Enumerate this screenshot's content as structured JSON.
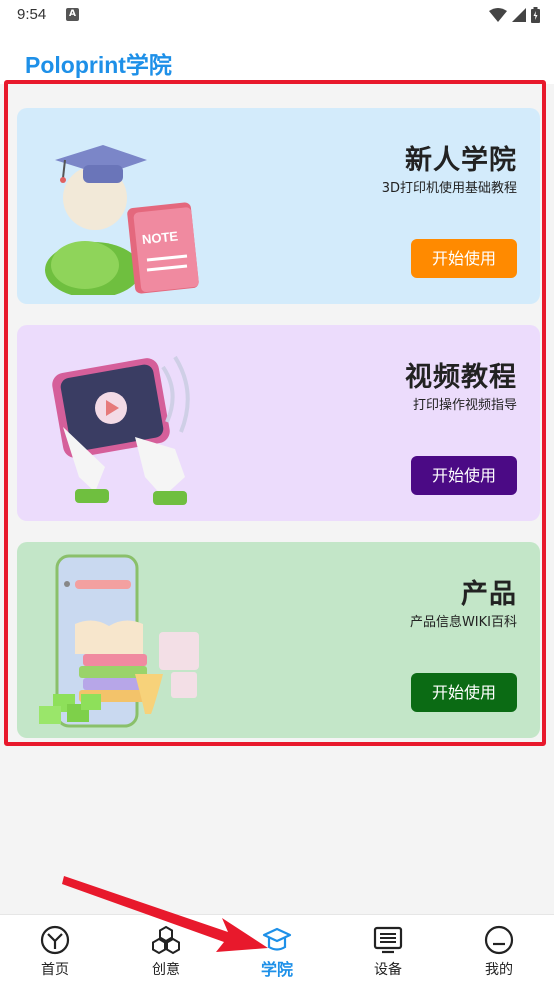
{
  "status_bar": {
    "time": "9:54",
    "notif_icon_letter": "A"
  },
  "header": {
    "title": "Poloprint学院"
  },
  "cards": [
    {
      "title": "新人学院",
      "subtitle": "3D打印机使用基础教程",
      "button": "开始使用",
      "button_color": "#ff8a00",
      "bg": "#d3ebfb"
    },
    {
      "title": "视频教程",
      "subtitle": "打印操作视频指导",
      "button": "开始使用",
      "button_color": "#4b0a85",
      "bg": "#ecdcfc"
    },
    {
      "title": "产品",
      "subtitle": "产品信息WIKI百科",
      "button": "开始使用",
      "button_color": "#0b6b14",
      "bg": "#c3e6c8"
    }
  ],
  "nav": {
    "items": [
      {
        "label": "首页",
        "icon": "clock-icon"
      },
      {
        "label": "创意",
        "icon": "hexagons-icon"
      },
      {
        "label": "学院",
        "icon": "graduation-cap-icon",
        "active": true
      },
      {
        "label": "设备",
        "icon": "device-list-icon"
      },
      {
        "label": "我的",
        "icon": "profile-face-icon"
      }
    ],
    "active_color": "#1e90e8"
  },
  "annotation": {
    "highlight_color": "#e8192c"
  }
}
